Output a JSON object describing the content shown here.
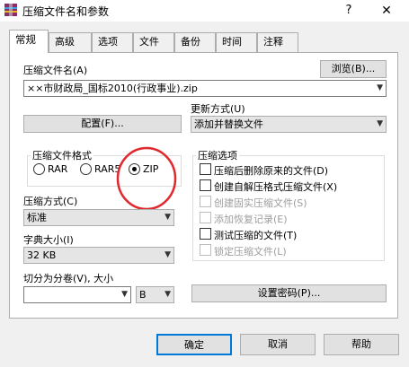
{
  "window": {
    "title": "压缩文件名和参数",
    "help": "?",
    "close": "✕"
  },
  "tabs": [
    "常规",
    "高级",
    "选项",
    "文件",
    "备份",
    "时间",
    "注释"
  ],
  "archive": {
    "name_label": "压缩文件名(A)",
    "browse_label": "浏览(B)...",
    "name_value": "××市财政局_国标2010(行政事业).zip",
    "profiles_label": "配置(F)..."
  },
  "update_mode": {
    "label": "更新方式(U)",
    "value": "添加并替换文件"
  },
  "format": {
    "label": "压缩文件格式",
    "options": [
      "RAR",
      "RAR5",
      "ZIP"
    ],
    "selected": "ZIP"
  },
  "method": {
    "label": "压缩方式(C)",
    "value": "标准"
  },
  "dictionary": {
    "label": "字典大小(I)",
    "value": "32 KB"
  },
  "split": {
    "label": "切分为分卷(V), 大小",
    "value": "",
    "unit": "B"
  },
  "options": {
    "label": "压缩选项",
    "items": [
      {
        "label": "压缩后删除原来的文件(D)",
        "disabled": false
      },
      {
        "label": "创建自解压格式压缩文件(X)",
        "disabled": false
      },
      {
        "label": "创建固实压缩文件(S)",
        "disabled": true
      },
      {
        "label": "添加恢复记录(E)",
        "disabled": true
      },
      {
        "label": "测试压缩的文件(T)",
        "disabled": false
      },
      {
        "label": "锁定压缩文件(L)",
        "disabled": true
      }
    ]
  },
  "password_label": "设置密码(P)...",
  "buttons": {
    "ok": "确定",
    "cancel": "取消",
    "help": "帮助"
  },
  "annotation_color": "#e0282d"
}
